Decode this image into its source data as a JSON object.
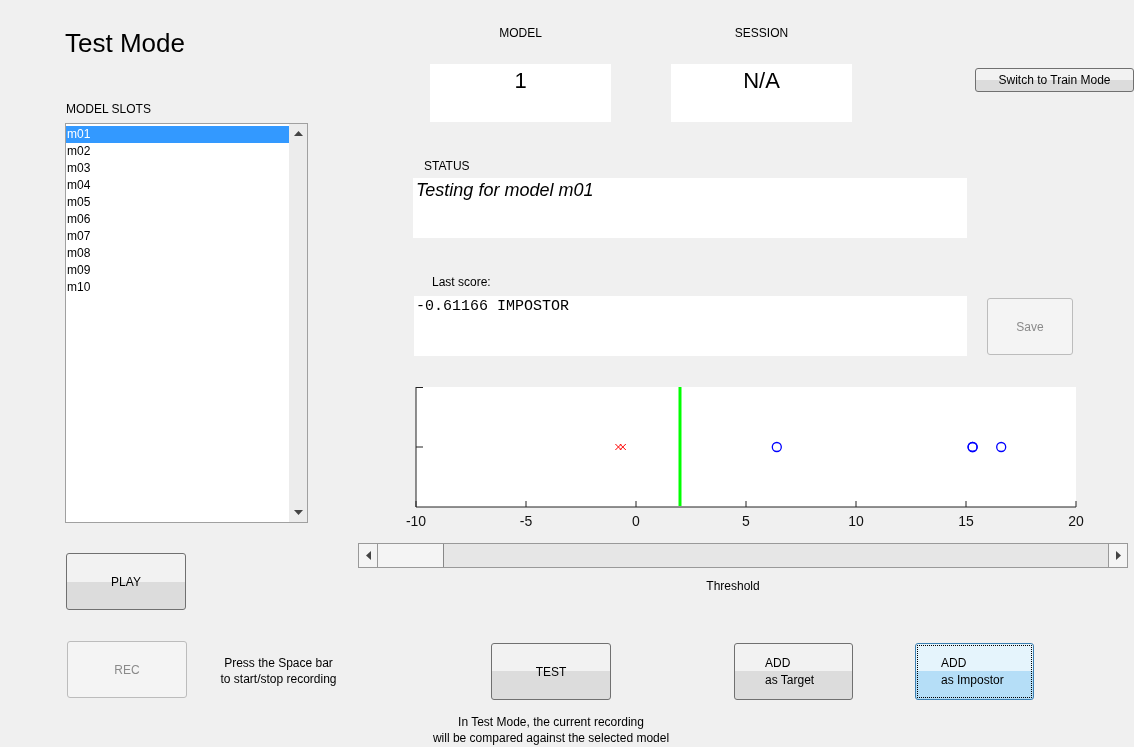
{
  "title": "Test Mode",
  "model": {
    "label": "MODEL",
    "value": "1"
  },
  "session": {
    "label": "SESSION",
    "value": "N/A"
  },
  "switch_button": {
    "label": "Switch to Train Mode",
    "disabled": false
  },
  "model_slots": {
    "label": "MODEL SLOTS",
    "items": [
      {
        "label": "m01",
        "selected": true
      },
      {
        "label": "m02",
        "selected": false
      },
      {
        "label": "m03",
        "selected": false
      },
      {
        "label": "m04",
        "selected": false
      },
      {
        "label": "m05",
        "selected": false
      },
      {
        "label": "m06",
        "selected": false
      },
      {
        "label": "m07",
        "selected": false
      },
      {
        "label": "m08",
        "selected": false
      },
      {
        "label": "m09",
        "selected": false
      },
      {
        "label": "m10",
        "selected": false
      }
    ]
  },
  "status": {
    "label": "STATUS",
    "value": "Testing for model m01"
  },
  "last_score": {
    "label": "Last score:",
    "value": "-0.61166 IMPOSTOR"
  },
  "save_button": {
    "label": "Save",
    "disabled": true
  },
  "score_plot": {
    "chart_data": {
      "type": "scatter",
      "orientation": "horizontal",
      "categories": [
        null
      ],
      "xlim": [
        -10,
        20
      ],
      "xticks": [
        {
          "value": -10,
          "label": "-10"
        },
        {
          "value": -5,
          "label": "-5"
        },
        {
          "value": 0,
          "label": "0"
        },
        {
          "value": 5,
          "label": "5"
        },
        {
          "value": 10,
          "label": "10"
        },
        {
          "value": 15,
          "label": "15"
        },
        {
          "value": 20,
          "label": "20"
        }
      ],
      "series": [
        {
          "color": "#ff0000",
          "marker": "x",
          "values": [
            -0.8
          ]
        },
        {
          "color": "#ff0000",
          "marker": "x",
          "values": [
            -0.6
          ]
        },
        {
          "color": "#0000ff",
          "marker": "o",
          "values": [
            6.4
          ]
        },
        {
          "color": "#0000ff",
          "marker": "o",
          "values": [
            15.3
          ]
        },
        {
          "color": "#0000ff",
          "marker": "o",
          "values": [
            15.3
          ]
        },
        {
          "color": "#0000ff",
          "marker": "o",
          "values": [
            16.6
          ]
        }
      ],
      "ref_lines": [
        {
          "axis": "x",
          "value": 2,
          "color": "#00ff00"
        }
      ]
    }
  },
  "threshold_slider": {
    "level": 0,
    "label": "Threshold"
  },
  "play_button": {
    "label": "PLAY",
    "disabled": false,
    "focused": false
  },
  "rec_button": {
    "label": "REC",
    "disabled": true,
    "focused": false
  },
  "rec_hint": [
    "Press the Space bar",
    "to start/stop recording"
  ],
  "test_button": {
    "label": "TEST",
    "disabled": false,
    "focused": false
  },
  "test_note": [
    "In Test Mode, the current recording",
    "will be compared against the selected model"
  ],
  "add_buttons": [
    {
      "lines": [
        "ADD",
        "as Target"
      ],
      "disabled": false,
      "focused": false
    },
    {
      "lines": [
        "ADD",
        "as Impostor"
      ],
      "disabled": false,
      "focused": true
    }
  ]
}
